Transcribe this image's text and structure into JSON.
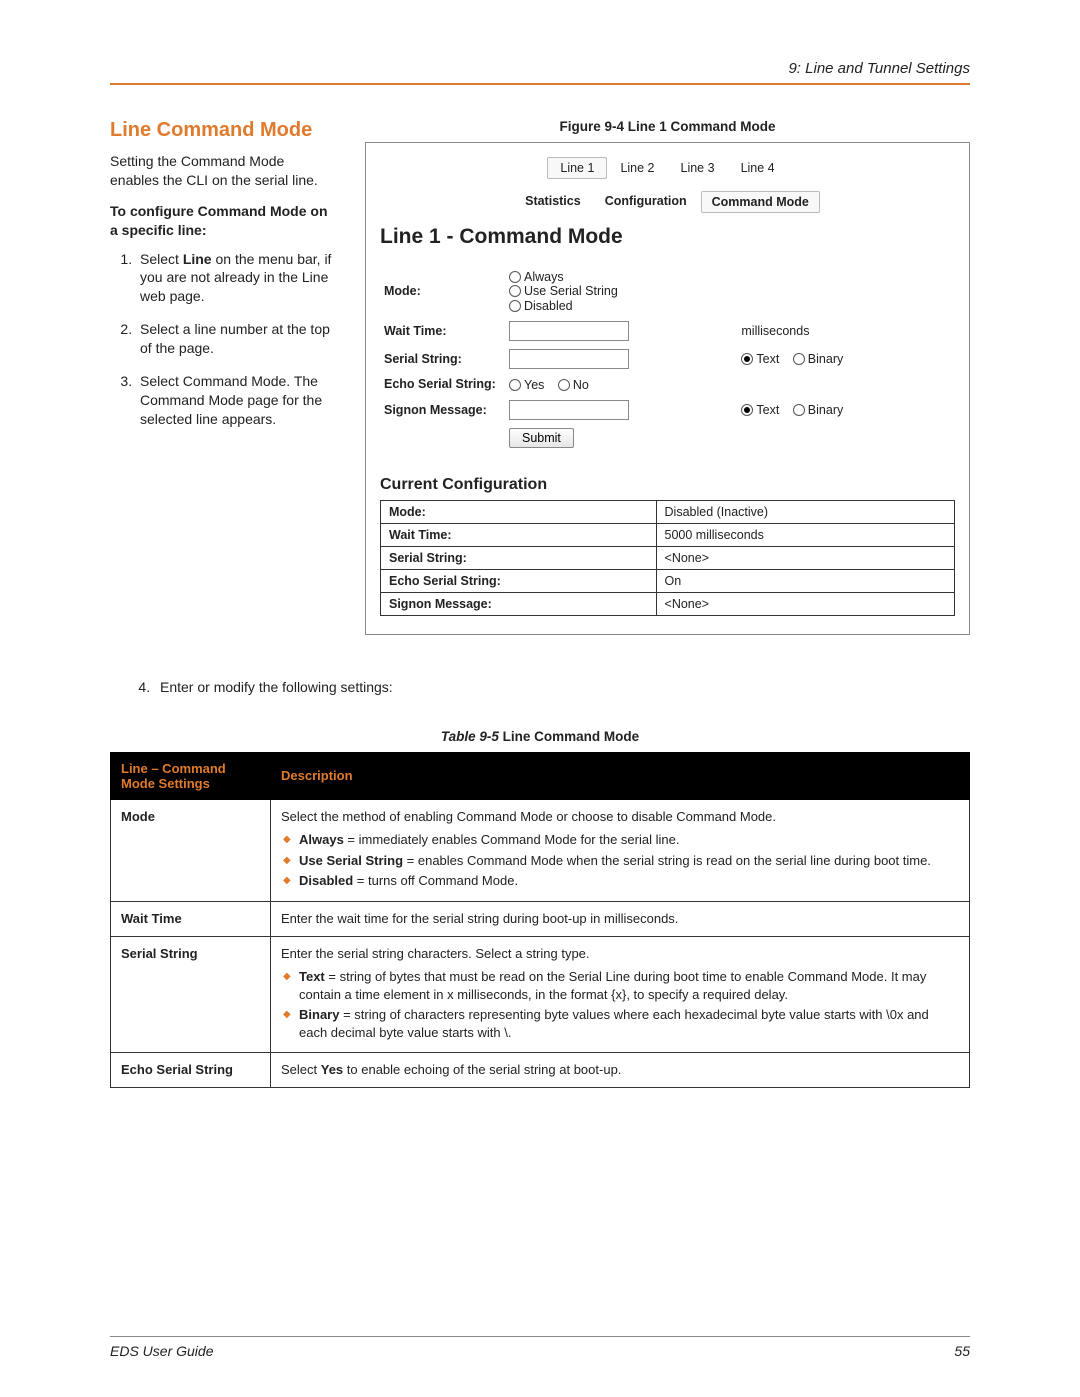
{
  "header": {
    "chapter": "9: Line and Tunnel Settings"
  },
  "section": {
    "title": "Line Command Mode",
    "intro": "Setting the Command Mode enables the CLI on the serial line.",
    "subhead": "To configure Command Mode on a specific line:",
    "steps": [
      "Select Line on the menu bar, if you are not already in the Line web page.",
      "Select a line number at the top of the page.",
      "Select Command Mode. The Command Mode page for the selected line appears."
    ],
    "step4": "Enter or modify the following settings:"
  },
  "figure": {
    "caption": "Figure 9-4  Line 1 Command Mode",
    "line_tabs": [
      "Line 1",
      "Line 2",
      "Line 3",
      "Line 4"
    ],
    "subtabs": [
      "Statistics",
      "Configuration",
      "Command Mode"
    ],
    "active_subtab": "Command Mode",
    "page_title": "Line 1 - Command Mode",
    "form": {
      "mode_label": "Mode:",
      "mode_options": [
        "Always",
        "Use Serial String",
        "Disabled"
      ],
      "wait_label": "Wait Time:",
      "wait_unit": "milliseconds",
      "serial_label": "Serial String:",
      "type_text": "Text",
      "type_binary": "Binary",
      "echo_label": "Echo Serial String:",
      "echo_yes": "Yes",
      "echo_no": "No",
      "signon_label": "Signon Message:",
      "submit": "Submit"
    },
    "current": {
      "title": "Current Configuration",
      "rows": [
        {
          "k": "Mode:",
          "v": "Disabled (Inactive)"
        },
        {
          "k": "Wait Time:",
          "v": "5000 milliseconds"
        },
        {
          "k": "Serial String:",
          "v": "<None>"
        },
        {
          "k": "Echo Serial String:",
          "v": "On"
        },
        {
          "k": "Signon Message:",
          "v": "<None>"
        }
      ]
    }
  },
  "table": {
    "caption_prefix": "Table 9-5",
    "caption_text": "  Line Command Mode",
    "col1": "Line – Command Mode Settings",
    "col2": "Description",
    "rows": {
      "mode": {
        "label": "Mode",
        "lead": "Select the method of enabling Command Mode or choose to disable Command Mode.",
        "b1_label": "Always",
        "b1_rest": " = immediately enables Command Mode for the serial line.",
        "b2_label": "Use Serial String",
        "b2_rest": " = enables Command Mode when the serial string is read on the serial line during boot time.",
        "b3_label": "Disabled",
        "b3_rest": " = turns off Command Mode."
      },
      "wait": {
        "label": "Wait Time",
        "text": "Enter the wait time for the serial string during boot-up in milliseconds."
      },
      "serial": {
        "label": "Serial String",
        "lead": "Enter the serial string characters. Select a string type.",
        "b1_label": "Text",
        "b1_rest": " = string of bytes that must be read on the Serial Line during boot time to enable Command Mode. It may contain a time element in x milliseconds, in the format {x}, to specify a required delay.",
        "b2_label": "Binary",
        "b2_rest": " = string of characters representing byte values where each hexadecimal byte value starts with \\0x and each decimal byte value starts with \\."
      },
      "echo": {
        "label": "Echo Serial String",
        "t1": "Select ",
        "t_bold": "Yes",
        "t2": " to enable echoing of the serial string at boot-up."
      }
    }
  },
  "footer": {
    "left": "EDS User Guide",
    "right": "55"
  }
}
